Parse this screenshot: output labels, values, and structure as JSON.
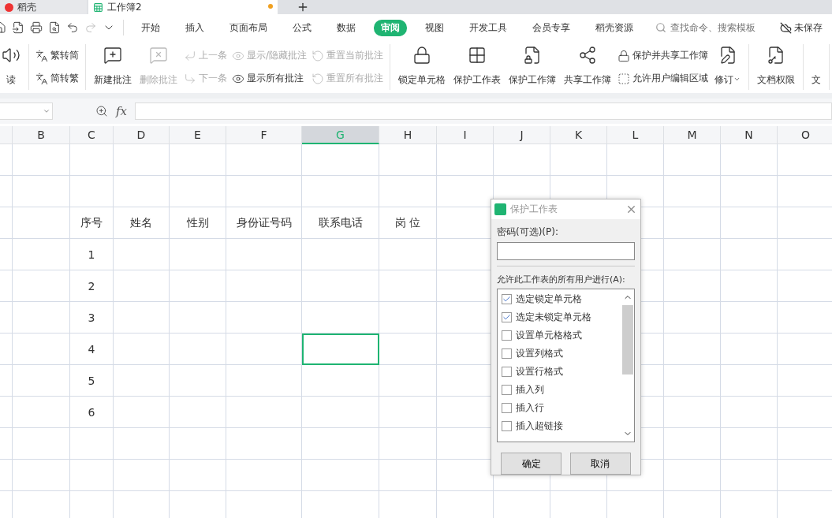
{
  "tabs": [
    {
      "label": "稻壳",
      "selected": false,
      "modified": false
    },
    {
      "label": "工作簿2",
      "selected": true,
      "modified": true
    }
  ],
  "menu": [
    {
      "label": "开始",
      "selected": false
    },
    {
      "label": "插入",
      "selected": false
    },
    {
      "label": "页面布局",
      "selected": false
    },
    {
      "label": "公式",
      "selected": false
    },
    {
      "label": "数据",
      "selected": false
    },
    {
      "label": "审阅",
      "selected": true
    },
    {
      "label": "视图",
      "selected": false
    },
    {
      "label": "开发工具",
      "selected": false
    },
    {
      "label": "会员专享",
      "selected": false
    },
    {
      "label": "稻壳资源",
      "selected": false
    }
  ],
  "search": {
    "placeholder": "查找命令、搜索模板"
  },
  "save_status": "未保存",
  "ribbon": [
    [
      {
        "kind": "big",
        "label": "读",
        "disabled": false
      }
    ],
    [
      {
        "kind": "stack",
        "items": [
          {
            "label": "繁转简",
            "disabled": false
          },
          {
            "label": "简转繁",
            "disabled": false
          }
        ]
      }
    ],
    [
      {
        "kind": "big",
        "label": "新建批注",
        "disabled": false
      },
      {
        "kind": "big",
        "label": "删除批注",
        "disabled": true
      },
      {
        "kind": "stack",
        "items": [
          {
            "label": "上一条",
            "disabled": true
          },
          {
            "label": "下一条",
            "disabled": true
          }
        ]
      },
      {
        "kind": "stack",
        "items": [
          {
            "label": "显示/隐藏批注",
            "disabled": true
          },
          {
            "label": "显示所有批注",
            "disabled": false
          }
        ]
      },
      {
        "kind": "stack",
        "items": [
          {
            "label": "重置当前批注",
            "disabled": true
          },
          {
            "label": "重置所有批注",
            "disabled": true
          }
        ]
      }
    ],
    [
      {
        "kind": "big",
        "label": "锁定单元格",
        "disabled": false
      },
      {
        "kind": "big",
        "label": "保护工作表",
        "disabled": false
      },
      {
        "kind": "big",
        "label": "保护工作簿",
        "disabled": false
      },
      {
        "kind": "big",
        "label": "共享工作簿",
        "disabled": false
      },
      {
        "kind": "stack",
        "items": [
          {
            "label": "保护并共享工作簿",
            "disabled": false
          },
          {
            "label": "允许用户编辑区域",
            "disabled": false
          }
        ]
      },
      {
        "kind": "big",
        "label": "修订",
        "disabled": false,
        "dropdown": true
      }
    ],
    [
      {
        "kind": "big",
        "label": "文档权限",
        "disabled": false
      }
    ],
    [
      {
        "kind": "big",
        "label": "文",
        "disabled": false
      }
    ]
  ],
  "formula_bar": {
    "fx": "fx"
  },
  "columns": [
    {
      "selected": false
    },
    {
      "label": "B",
      "selected": false
    },
    {
      "label": "C",
      "selected": false
    },
    {
      "label": "D",
      "selected": false
    },
    {
      "label": "E",
      "selected": false
    },
    {
      "label": "F",
      "selected": false
    },
    {
      "label": "G",
      "selected": true
    },
    {
      "label": "H",
      "selected": false
    },
    {
      "label": "I",
      "selected": false
    },
    {
      "label": "J",
      "selected": false
    },
    {
      "label": "K",
      "selected": false
    },
    {
      "label": "L",
      "selected": false
    },
    {
      "label": "M",
      "selected": false
    },
    {
      "label": "N",
      "selected": false
    },
    {
      "label": "O",
      "selected": false
    }
  ],
  "rows": [
    {
      "selected": false
    },
    {
      "selected": false
    },
    {
      "cells": [
        "序号",
        "姓名",
        "性别",
        "身份证号码",
        "联系电话",
        "岗 位"
      ],
      "selected": false
    },
    {
      "cells": [
        "1"
      ],
      "selected": false
    },
    {
      "cells": [
        "2"
      ],
      "selected": false
    },
    {
      "cells": [
        "3"
      ],
      "selected": false
    },
    {
      "cells": [
        "4"
      ],
      "selected": true
    },
    {
      "cells": [
        "5"
      ],
      "selected": false
    },
    {
      "cells": [
        "6"
      ],
      "selected": false
    },
    {
      "selected": false
    },
    {
      "selected": false
    },
    {
      "selected": false
    }
  ],
  "dialog": {
    "title": "保护工作表",
    "password_label": "密码(可选)(P):",
    "allow_label": "允许此工作表的所有用户进行(A):",
    "options": [
      {
        "label": "选定锁定单元格",
        "checked": true
      },
      {
        "label": "选定未锁定单元格",
        "checked": true
      },
      {
        "label": "设置单元格格式",
        "checked": false
      },
      {
        "label": "设置列格式",
        "checked": false
      },
      {
        "label": "设置行格式",
        "checked": false
      },
      {
        "label": "插入列",
        "checked": false
      },
      {
        "label": "插入行",
        "checked": false
      },
      {
        "label": "插入超链接",
        "checked": false
      }
    ],
    "buttons": [
      "确定",
      "取消"
    ]
  }
}
